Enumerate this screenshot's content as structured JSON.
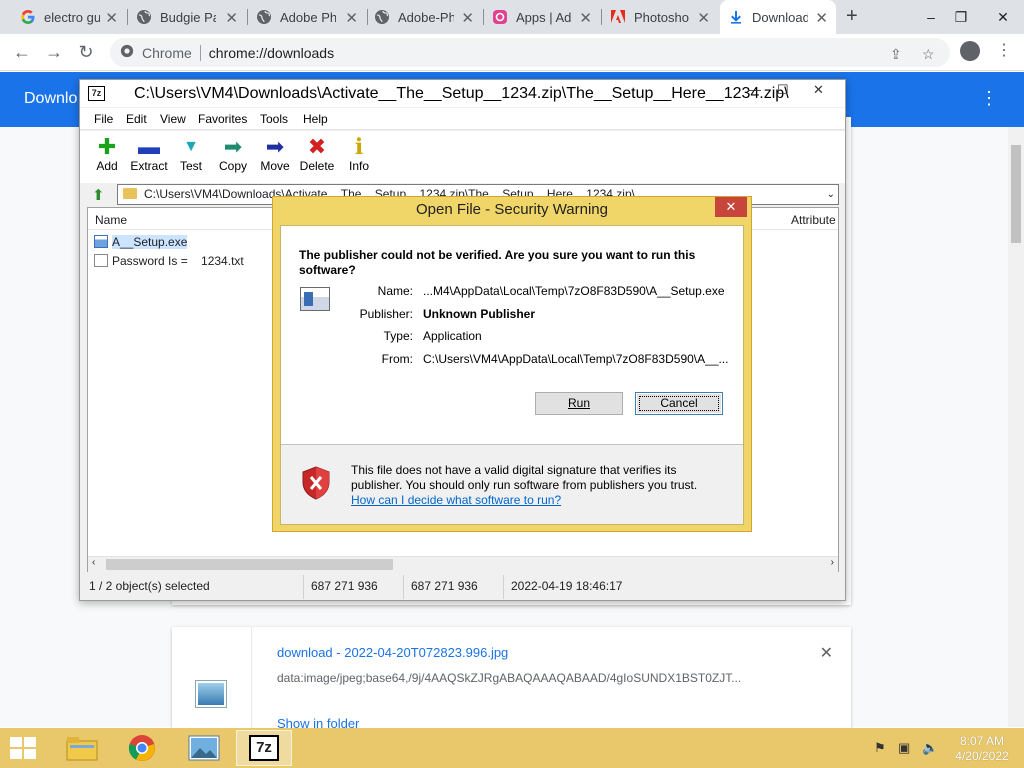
{
  "browser": {
    "tabs": [
      {
        "title": "electro gu",
        "icon": "google-icon"
      },
      {
        "title": "Budgie Pa",
        "icon": "globe-icon"
      },
      {
        "title": "Adobe Ph",
        "icon": "globe-icon"
      },
      {
        "title": "Adobe-Ph",
        "icon": "globe-icon"
      },
      {
        "title": "Apps | Ad",
        "icon": "adobe-cc-icon"
      },
      {
        "title": "Photosho",
        "icon": "adobe-icon"
      },
      {
        "title": "Download",
        "icon": "download-icon",
        "active": true
      }
    ],
    "omnibox_label": "Chrome",
    "omnibox_url": "chrome://downloads"
  },
  "downloads_page": {
    "header_title": "Downlo",
    "item": {
      "title": "download - 2022-04-20T072823.996.jpg",
      "url": "data:image/jpeg;base64,/9j/4AAQSkZJRgABAQAAAQABAAD/4gIoSUNDX1BST0ZJT...",
      "show_in_folder": "Show in folder"
    }
  },
  "zip_window": {
    "title": "C:\\Users\\VM4\\Downloads\\Activate__The__Setup__1234.zip\\The__Setup__Here__1234.zip\\",
    "logo": "7z",
    "menu": [
      "File",
      "Edit",
      "View",
      "Favorites",
      "Tools",
      "Help"
    ],
    "tools": [
      {
        "label": "Add",
        "icon": "add-icon",
        "color": "#1aa31a",
        "glyph": "✚"
      },
      {
        "label": "Extract",
        "icon": "extract-icon",
        "color": "#1f3fb8",
        "glyph": "▬"
      },
      {
        "label": "Test",
        "icon": "test-icon",
        "color": "#1fa7b8",
        "glyph": "▼"
      },
      {
        "label": "Copy",
        "icon": "copy-icon",
        "color": "#1f8a6e",
        "glyph": "➡"
      },
      {
        "label": "Move",
        "icon": "move-icon",
        "color": "#1f2fa0",
        "glyph": "➡"
      },
      {
        "label": "Delete",
        "icon": "delete-icon",
        "color": "#d42020",
        "glyph": "✖"
      },
      {
        "label": "Info",
        "icon": "info-icon",
        "color": "#c9a800",
        "glyph": "ℹ"
      }
    ],
    "address": "C:\\Users\\VM4\\Downloads\\Activate__The__Setup__1234.zip\\The__Setup__Here__1234.zip\\",
    "columns": {
      "name": "Name",
      "attributes": "Attribute"
    },
    "files": [
      {
        "name": "A__Setup.exe",
        "type": "exe"
      },
      {
        "name": "Password Is =    1234.txt",
        "type": "txt"
      }
    ],
    "status": {
      "selection": "1 / 2 object(s) selected",
      "size": "687 271 936",
      "packed": "687 271 936",
      "modified": "2022-04-19 18:46:17"
    }
  },
  "security_dialog": {
    "title": "Open File - Security Warning",
    "question": "The publisher could not be verified.  Are you sure you want to run this software?",
    "fields": [
      {
        "label": "Name:",
        "value": "...M4\\AppData\\Local\\Temp\\7zO8F83D590\\A__Setup.exe",
        "bold": false
      },
      {
        "label": "Publisher:",
        "value": "Unknown Publisher",
        "bold": true
      },
      {
        "label": "Type:",
        "value": "Application",
        "bold": false
      },
      {
        "label": "From:",
        "value": "C:\\Users\\VM4\\AppData\\Local\\Temp\\7zO8F83D590\\A__...",
        "bold": false
      }
    ],
    "run_label": "Run",
    "cancel_label": "Cancel",
    "warning": "This file does not have a valid digital signature that verifies its publisher.  You should only run software from publishers you trust.",
    "help_link": "How can I decide what software to run?"
  },
  "taskbar": {
    "apps": [
      {
        "name": "file-explorer",
        "icon": "folder-icon"
      },
      {
        "name": "chrome",
        "icon": "chrome-icon"
      },
      {
        "name": "photos",
        "icon": "image-viewer-icon"
      },
      {
        "name": "7zip",
        "icon": "7zip-icon",
        "label": "7z",
        "active": true
      }
    ],
    "time": "8:07 AM",
    "date": "4/20/2022"
  },
  "colors": {
    "chrome_blue": "#1a73e8",
    "dialog_frame": "#f0d568",
    "taskbar": "#e8c86a"
  }
}
